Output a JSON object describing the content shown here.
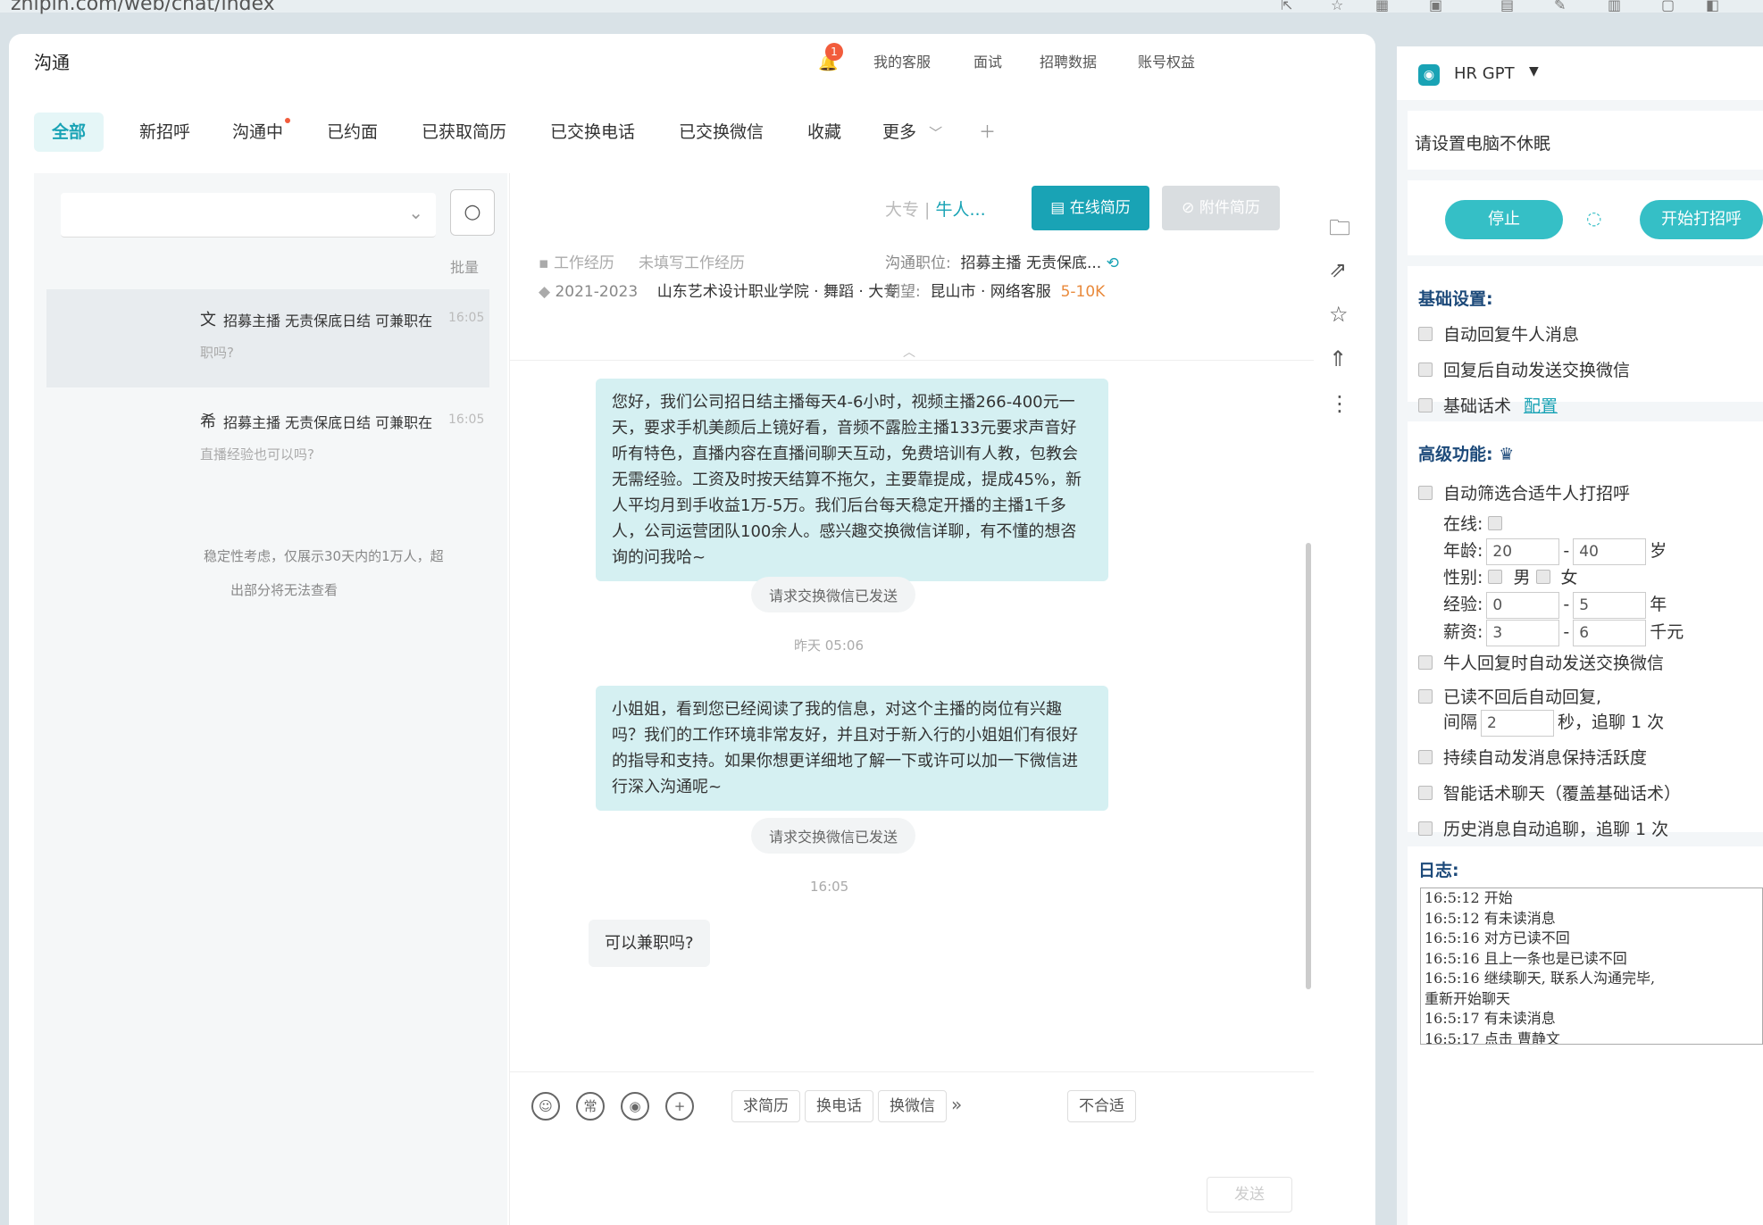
{
  "browser": {
    "url": "zhipin.com/web/chat/index"
  },
  "app": {
    "title": "沟通",
    "notify_count": "1",
    "topnav": [
      "我的客服",
      "面试",
      "招聘数据",
      "账号权益"
    ]
  },
  "tabs": [
    "全部",
    "新招呼",
    "沟通中",
    "已约面",
    "已获取简历",
    "已交换电话",
    "已交换微信",
    "收藏",
    "更多"
  ],
  "left": {
    "batch": "批量",
    "conversations": [
      {
        "name": "文",
        "title": "招募主播 无责保底日结 可兼职在",
        "time": "16:05",
        "preview": "职吗?"
      },
      {
        "name": "希",
        "title": "招募主播 无责保底日结 可兼职在",
        "time": "16:05",
        "preview": "直播经验也可以吗?"
      }
    ],
    "notice_line1": "稳定性考虑，仅展示30天内的1万人，超",
    "notice_line2": "出部分将无法查看"
  },
  "chat": {
    "candidate_edu": "大专",
    "candidate_tag": "牛人...",
    "online_resume": "在线简历",
    "attach_resume": "附件简历",
    "work_label": "工作经历",
    "work_value": "未填写工作经历",
    "edu_years": "2021-2023",
    "edu_value": "山东艺术设计职业学院 · 舞蹈 · 大专",
    "job_label": "沟通职位:",
    "job_value": "招募主播 无责保底...",
    "expect_label": "期望:",
    "expect_value": "昆山市 · 网络客服",
    "expect_salary": "5-10K",
    "msg1": "您好，我们公司招日结主播每天4-6小时，视频主播266-400元一天，要求手机美颜后上镜好看，音频不露脸主播133元要求声音好听有特色，直播内容在直播间聊天互动，免费培训有人教，包教会无需经验。工资及时按天结算不拖欠，主要靠提成，提成45%，新人平均月到手收益1万-5万。我们后台每天稳定开播的主播1千多人，公司运营团队100余人。感兴趣交换微信详聊，有不懂的想咨询的问我哈~",
    "sys1": "请求交换微信已发送",
    "stamp1": "昨天 05:06",
    "msg2": "小姐姐，看到您已经阅读了我的信息，对这个主播的岗位有兴趣吗？我们的工作环境非常友好，并且对于新入行的小姐姐们有很好的指导和支持。如果你想更详细地了解一下或许可以加一下微信进行深入沟通呢~",
    "sys2": "请求交换微信已发送",
    "stamp2": "16:05",
    "msg3": "可以兼职吗?",
    "tools": [
      "求简历",
      "换电话",
      "换微信"
    ],
    "reject": "不合适",
    "send": "发送",
    "tool_icon_chang": "常"
  },
  "gpt": {
    "name": "HR GPT",
    "notice": "请设置电脑不休眠",
    "stop": "停止",
    "start": "开始打招呼",
    "basic_title": "基础设置:",
    "basic": [
      "自动回复牛人消息",
      "回复后自动发送交换微信",
      "基础话术"
    ],
    "config_link": "配置",
    "adv_title": "高级功能:",
    "auto_filter": "自动筛选合适牛人打招呼",
    "online_label": "在线:",
    "age_label": "年龄:",
    "age_min": "20",
    "age_max": "40",
    "age_unit": "岁",
    "gender_label": "性别:",
    "male": "男",
    "female": "女",
    "exp_label": "经验:",
    "exp_min": "0",
    "exp_max": "5",
    "exp_unit": "年",
    "salary_label": "薪资:",
    "salary_min": "3",
    "salary_max": "6",
    "salary_unit": "千元",
    "adv": [
      "牛人回复时自动发送交换微信",
      "已读不回后自动回复,"
    ],
    "interval_label": "间隔",
    "interval_value": "2",
    "interval_suffix": "秒，追聊 1 次",
    "adv2": [
      "持续自动发消息保持活跃度",
      "智能话术聊天（覆盖基础话术）",
      "历史消息自动追聊，追聊 1 次"
    ],
    "log_title": "日志:",
    "log": [
      "16:5:12 开始",
      "16:5:12 有未读消息",
      "16:5:16 对方已读不回",
      "16:5:16 且上一条也是已读不回",
      "16:5:16 继续聊天, 联系人沟通完毕,",
      "重新开始聊天",
      "16:5:17 有未读消息",
      "16:5:17 点击 曹静文"
    ]
  },
  "colors": {
    "accent": "#19a3b5",
    "bubble_out": "#d5f0f2",
    "bubble_in": "#f2f4f5",
    "pill": "#35bfc6"
  }
}
